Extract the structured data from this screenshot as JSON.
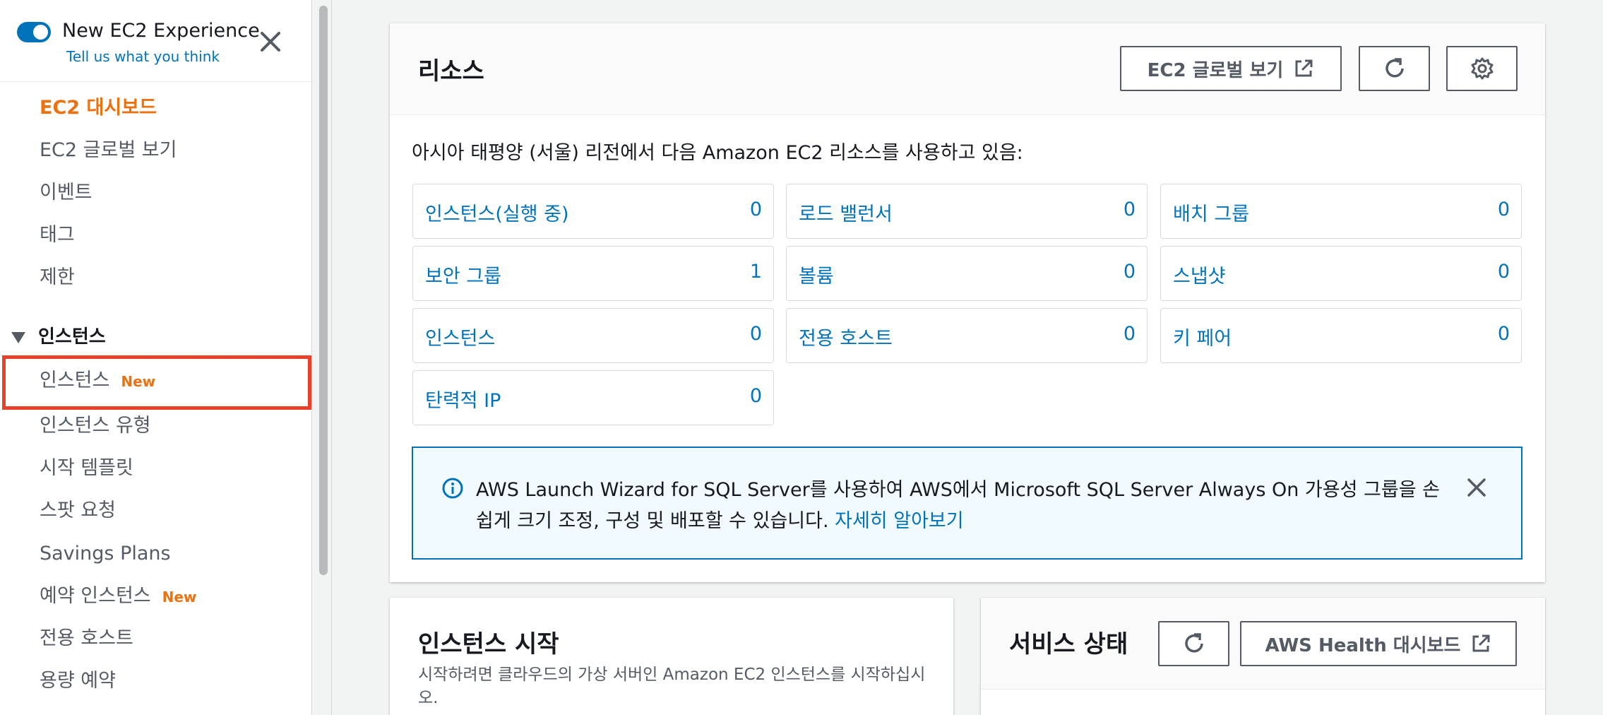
{
  "sidebar": {
    "toggle_title": "New EC2 Experience",
    "feedback_link": "Tell us what you think",
    "items": [
      {
        "label": "EC2 대시보드",
        "active": true
      },
      {
        "label": "EC2 글로벌 보기"
      },
      {
        "label": "이벤트"
      },
      {
        "label": "태그"
      },
      {
        "label": "제한"
      }
    ],
    "section_title": "인스턴스",
    "section_items": [
      {
        "label": "인스턴스",
        "badge": "New"
      },
      {
        "label": "인스턴스 유형"
      },
      {
        "label": "시작 템플릿"
      },
      {
        "label": "스팟 요청"
      },
      {
        "label": "Savings Plans"
      },
      {
        "label": "예약 인스턴스",
        "badge": "New"
      },
      {
        "label": "전용 호스트"
      },
      {
        "label": "용량 예약"
      }
    ]
  },
  "resources": {
    "title": "리소스",
    "global_view_button": "EC2 글로벌 보기",
    "description": "아시아 태평양 (서울) 리전에서 다음 Amazon EC2 리소스를 사용하고 있음:",
    "tiles": [
      {
        "label": "인스턴스(실행 중)",
        "value": "0"
      },
      {
        "label": "로드 밸런서",
        "value": "0"
      },
      {
        "label": "배치 그룹",
        "value": "0"
      },
      {
        "label": "보안 그룹",
        "value": "1"
      },
      {
        "label": "볼륨",
        "value": "0"
      },
      {
        "label": "스냅샷",
        "value": "0"
      },
      {
        "label": "인스턴스",
        "value": "0"
      },
      {
        "label": "전용 호스트",
        "value": "0"
      },
      {
        "label": "키 페어",
        "value": "0"
      },
      {
        "label": "탄력적 IP",
        "value": "0"
      }
    ],
    "info_text": "AWS Launch Wizard for SQL Server를 사용하여 AWS에서 Microsoft SQL Server Always On 가용성 그룹을 손쉽게 크기 조정, 구성 및 배포할 수 있습니다.",
    "info_link": "자세히 알아보기"
  },
  "launch": {
    "title": "인스턴스 시작",
    "description": "시작하려면 클라우드의 가상 서버인 Amazon EC2 인스턴스를 시작하십시오."
  },
  "service_health": {
    "title": "서비스 상태",
    "health_button": "AWS Health 대시보드"
  },
  "colors": {
    "accent_orange": "#ec7211",
    "link_blue": "#0073bb",
    "highlight_red": "#e8412b"
  }
}
